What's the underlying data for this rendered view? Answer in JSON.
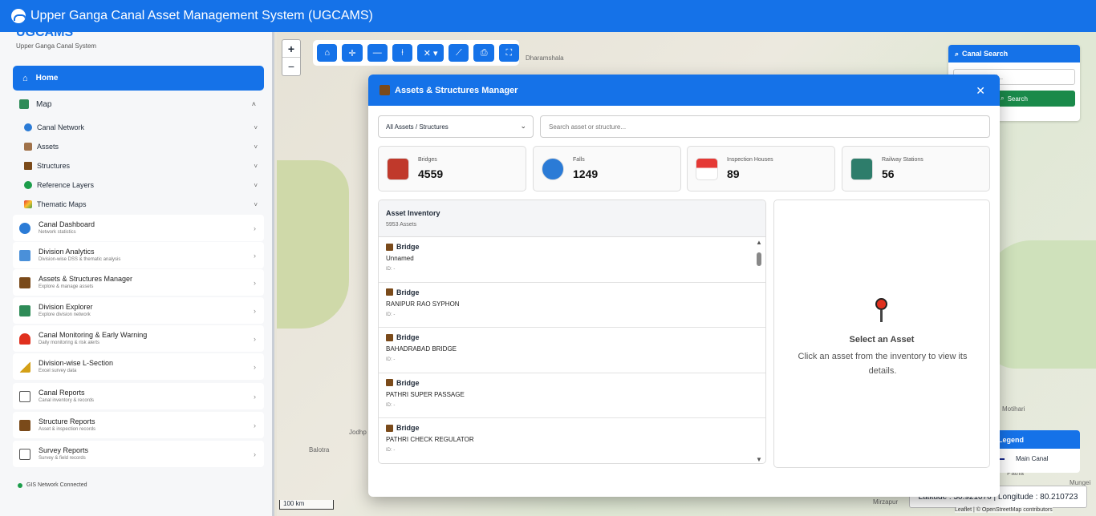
{
  "app": {
    "title": "Upper Ganga Canal Asset Management System (UGCAMS)"
  },
  "sidebar": {
    "brand": "UGCAMS",
    "brand_sub": "Upper Ganga Canal System",
    "home": "Home",
    "map": "Map",
    "map_items": [
      {
        "label": "Canal Network"
      },
      {
        "label": "Assets"
      },
      {
        "label": "Structures"
      },
      {
        "label": "Reference Layers"
      },
      {
        "label": "Thematic Maps"
      }
    ],
    "cards": [
      {
        "title": "Canal Dashboard",
        "sub": "Network statistics"
      },
      {
        "title": "Division Analytics",
        "sub": "Division-wise DSS & thematic analysis"
      },
      {
        "title": "Assets & Structures Manager",
        "sub": "Explore & manage assets"
      },
      {
        "title": "Division Explorer",
        "sub": "Explore division network"
      },
      {
        "title": "Canal Monitoring & Early Warning",
        "sub": "Daily monitoring & risk alerts"
      },
      {
        "title": "Division-wise L-Section",
        "sub": "Excel survey data"
      },
      {
        "title": "Canal Reports",
        "sub": "Canal inventory & records"
      },
      {
        "title": "Structure Reports",
        "sub": "Asset & inspection records"
      },
      {
        "title": "Survey Reports",
        "sub": "Survey & field records"
      }
    ],
    "status": "GIS Network Connected"
  },
  "map": {
    "zoom_in": "+",
    "zoom_out": "−",
    "scale": "100 km",
    "labels": [
      "Dharamshala",
      "Jodhp",
      "Balotra",
      "Motihari",
      "Patna",
      "Mirzapur",
      "Mungei"
    ],
    "canal_search": {
      "title": "Canal Search",
      "placeholder": "Search Canal...",
      "button": "Search"
    },
    "legend": {
      "title": "Legend",
      "item": "Main Canal"
    },
    "coords": "Latitude : 30.921076 | Longitude : 80.210723",
    "attribution": "Leaflet | © OpenStreetMap contributors"
  },
  "modal": {
    "title": "Assets & Structures Manager",
    "filter": "All Assets / Structures",
    "search_placeholder": "Search asset or structure...",
    "stats": [
      {
        "label": "Bridges",
        "value": "4559"
      },
      {
        "label": "Falls",
        "value": "1249"
      },
      {
        "label": "Inspection Houses",
        "value": "89"
      },
      {
        "label": "Railway Stations",
        "value": "56"
      }
    ],
    "inventory": {
      "title": "Asset Inventory",
      "count": "5953 Assets",
      "items": [
        {
          "type": "Bridge",
          "name": "Unnamed",
          "id": "ID: -"
        },
        {
          "type": "Bridge",
          "name": "RANIPUR RAO SYPHON",
          "id": "ID: -"
        },
        {
          "type": "Bridge",
          "name": "BAHADRABAD BRIDGE",
          "id": "ID: -"
        },
        {
          "type": "Bridge",
          "name": "PATHRI SUPER PASSAGE",
          "id": "ID: -"
        },
        {
          "type": "Bridge",
          "name": "PATHRI CHECK REGULATOR",
          "id": "ID: -"
        }
      ]
    },
    "detail": {
      "title": "Select an Asset",
      "text": "Click an asset from the inventory to view its details."
    }
  }
}
